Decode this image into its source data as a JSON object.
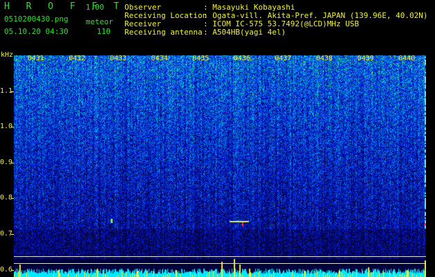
{
  "app": {
    "name": "H R O F F T",
    "version": "1.00"
  },
  "file": {
    "name": "0510200430.png",
    "datetime": "05.10.20 04:30"
  },
  "meteor": {
    "label": "meteor",
    "count": "110"
  },
  "info": [
    {
      "key": "Observer",
      "value": "Masayuki Kobayashi"
    },
    {
      "key": "Receiving Location",
      "value": "Ogata-vill. Akita-Pref. JAPAN (139.96E, 40.02N)"
    },
    {
      "key": "Receiver",
      "value": "ICOM IC-575 53.7492(@LCD)MHz USB"
    },
    {
      "key": "Receiving antenna",
      "value": "A504HB(yagi 4el)"
    }
  ],
  "axis": {
    "unit": "kHz",
    "time_labels": [
      "0431",
      "0432",
      "0433",
      "0434",
      "0435",
      "0436",
      "0437",
      "0438",
      "0439",
      "0440"
    ],
    "freq_labels": [
      "1.1",
      "1.0",
      "0.9",
      "0.8",
      "0.7",
      "0.6"
    ],
    "freq_range": [
      0.58,
      1.2
    ]
  },
  "colors": {
    "label": "#f2f23a",
    "brand": "#2de02d",
    "background": "#000000"
  }
}
